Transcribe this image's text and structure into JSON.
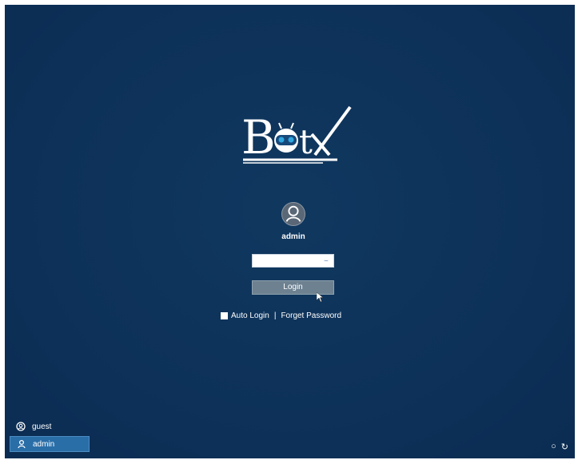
{
  "logo": {
    "text": "BotX",
    "alt": "BotX logo"
  },
  "login": {
    "username": "admin",
    "password_value": "",
    "login_label": "Login",
    "auto_login_label": "Auto Login",
    "separator": "|",
    "forgot_password_label": "Forget Password"
  },
  "users": [
    {
      "name": "guest",
      "icon": "user-circle-icon",
      "active": false
    },
    {
      "name": "admin",
      "icon": "user-icon",
      "active": true
    }
  ],
  "tray": {
    "power_icon": "power-icon",
    "cycle_icon": "refresh-icon"
  },
  "colors": {
    "background": "#0d3159",
    "accent": "#2a6ea8",
    "button": "#6d8191"
  }
}
